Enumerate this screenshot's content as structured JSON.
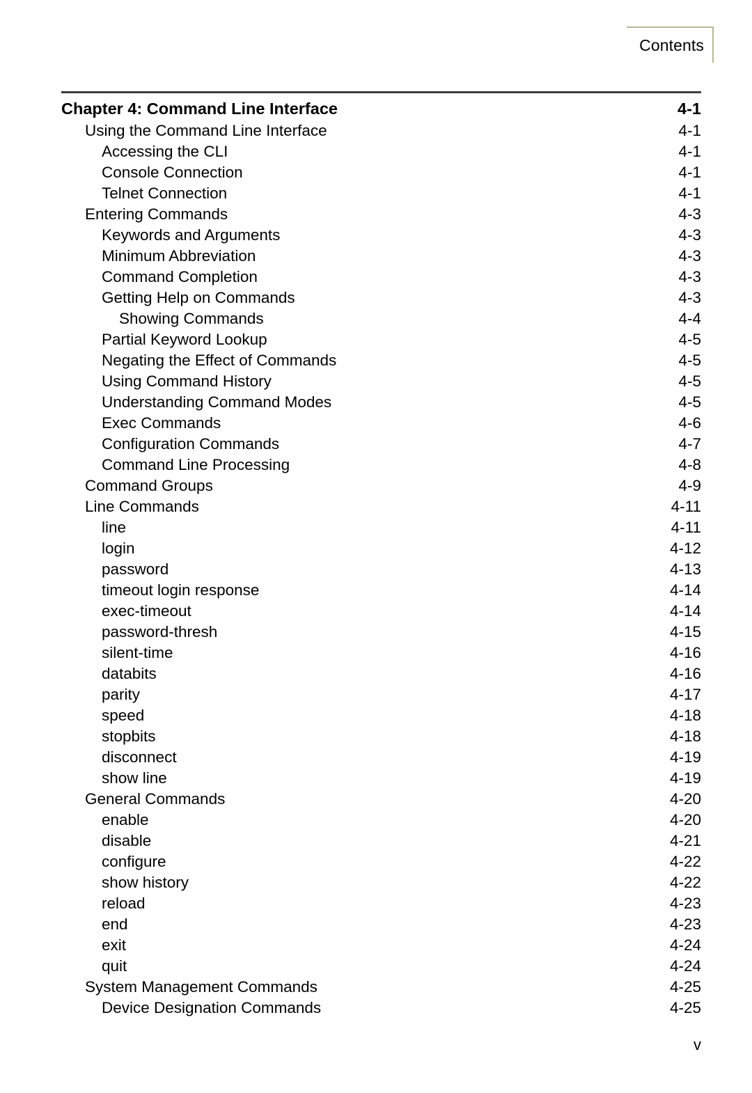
{
  "header": {
    "tab_label": "Contents"
  },
  "footer": {
    "page_label": "v"
  },
  "colors": {
    "text": "#000000",
    "rule": "#3b3b3b",
    "tab_border": "#b8b79a",
    "background": "#ffffff"
  },
  "toc": {
    "entries": [
      {
        "level": 0,
        "title": "Chapter 4: Command Line Interface",
        "page": "4-1"
      },
      {
        "level": 1,
        "title": "Using the Command Line Interface",
        "page": "4-1"
      },
      {
        "level": 2,
        "title": "Accessing the CLI",
        "page": "4-1"
      },
      {
        "level": 2,
        "title": "Console Connection",
        "page": "4-1"
      },
      {
        "level": 2,
        "title": "Telnet Connection",
        "page": "4-1"
      },
      {
        "level": 1,
        "title": "Entering Commands",
        "page": "4-3"
      },
      {
        "level": 2,
        "title": "Keywords and Arguments",
        "page": "4-3"
      },
      {
        "level": 2,
        "title": "Minimum Abbreviation",
        "page": "4-3"
      },
      {
        "level": 2,
        "title": "Command Completion",
        "page": "4-3"
      },
      {
        "level": 2,
        "title": "Getting Help on Commands",
        "page": "4-3"
      },
      {
        "level": 3,
        "title": "Showing Commands",
        "page": "4-4"
      },
      {
        "level": 2,
        "title": "Partial Keyword Lookup",
        "page": "4-5"
      },
      {
        "level": 2,
        "title": "Negating the Effect of Commands",
        "page": "4-5"
      },
      {
        "level": 2,
        "title": "Using Command History",
        "page": "4-5"
      },
      {
        "level": 2,
        "title": "Understanding Command Modes",
        "page": "4-5"
      },
      {
        "level": 2,
        "title": "Exec Commands",
        "page": "4-6"
      },
      {
        "level": 2,
        "title": "Configuration Commands",
        "page": "4-7"
      },
      {
        "level": 2,
        "title": "Command Line Processing",
        "page": "4-8"
      },
      {
        "level": 1,
        "title": "Command Groups",
        "page": "4-9"
      },
      {
        "level": 1,
        "title": "Line Commands",
        "page": "4-11"
      },
      {
        "level": 2,
        "title": "line",
        "page": "4-11"
      },
      {
        "level": 2,
        "title": "login",
        "page": "4-12"
      },
      {
        "level": 2,
        "title": "password",
        "page": "4-13"
      },
      {
        "level": 2,
        "title": "timeout login response",
        "page": "4-14"
      },
      {
        "level": 2,
        "title": "exec-timeout",
        "page": "4-14"
      },
      {
        "level": 2,
        "title": "password-thresh",
        "page": "4-15"
      },
      {
        "level": 2,
        "title": "silent-time",
        "page": "4-16"
      },
      {
        "level": 2,
        "title": "databits",
        "page": "4-16"
      },
      {
        "level": 2,
        "title": "parity",
        "page": "4-17"
      },
      {
        "level": 2,
        "title": "speed",
        "page": "4-18"
      },
      {
        "level": 2,
        "title": "stopbits",
        "page": "4-18"
      },
      {
        "level": 2,
        "title": "disconnect",
        "page": "4-19"
      },
      {
        "level": 2,
        "title": "show line",
        "page": "4-19"
      },
      {
        "level": 1,
        "title": "General Commands",
        "page": "4-20"
      },
      {
        "level": 2,
        "title": "enable",
        "page": "4-20"
      },
      {
        "level": 2,
        "title": "disable",
        "page": "4-21"
      },
      {
        "level": 2,
        "title": "configure",
        "page": "4-22"
      },
      {
        "level": 2,
        "title": "show history",
        "page": "4-22"
      },
      {
        "level": 2,
        "title": "reload",
        "page": "4-23"
      },
      {
        "level": 2,
        "title": "end",
        "page": "4-23"
      },
      {
        "level": 2,
        "title": "exit",
        "page": "4-24"
      },
      {
        "level": 2,
        "title": "quit",
        "page": "4-24"
      },
      {
        "level": 1,
        "title": "System Management Commands",
        "page": "4-25"
      },
      {
        "level": 2,
        "title": "Device Designation Commands",
        "page": "4-25"
      }
    ]
  }
}
